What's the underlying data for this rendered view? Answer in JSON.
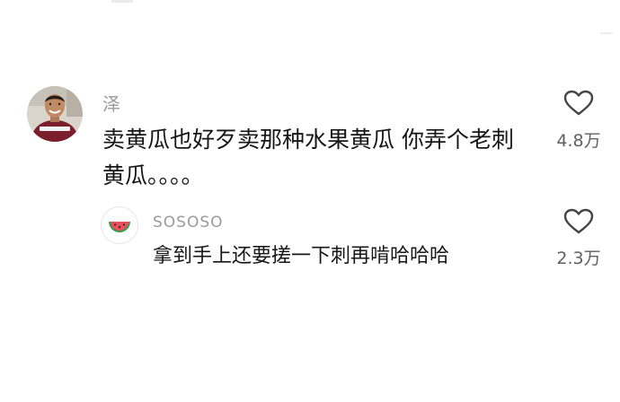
{
  "comments": [
    {
      "username": "泽",
      "text": "卖黄瓜也好歹卖那种水果黄瓜 你弄个老刺黄瓜。。。。",
      "likes": "4.8万",
      "avatar_icon": "person-photo-icon",
      "replies": [
        {
          "username": "SOSOSO",
          "text": "拿到手上还要搓一下刺再啃哈哈哈",
          "likes": "2.3万",
          "avatar_icon": "watermelon-icon"
        }
      ]
    }
  ],
  "colors": {
    "username": "#9a9a9a",
    "text": "#161616",
    "like_count": "#5f5f5f",
    "heart_outline": "#444444",
    "watermelon_flesh": "#e8505b",
    "watermelon_rind": "#3a9b4a"
  }
}
